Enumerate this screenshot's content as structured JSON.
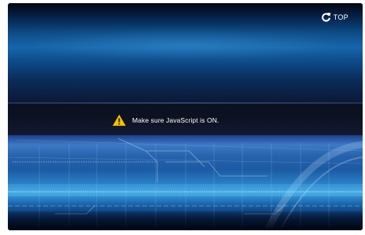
{
  "header": {
    "top_link_label": "TOP",
    "top_link_icon": "refresh-arrow-icon"
  },
  "notice": {
    "icon": "warning-icon",
    "message": "Make sure JavaScript is ON."
  },
  "colors": {
    "background": "#061027",
    "accent": "#3aa4e0",
    "warning": "#f2c500",
    "text": "#ffffff"
  }
}
